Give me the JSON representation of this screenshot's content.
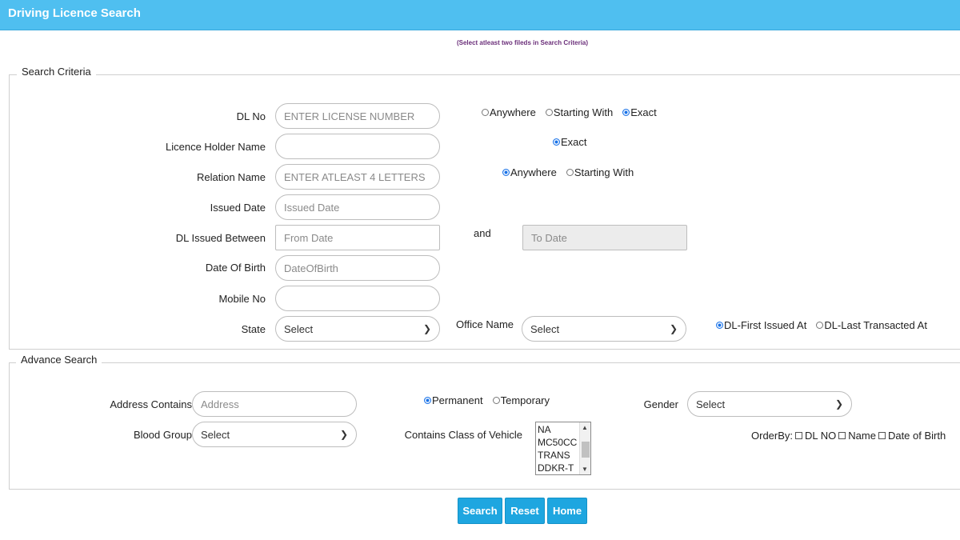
{
  "header": {
    "title": "Driving Licence Search"
  },
  "note": "(Select atleast two fileds in Search Criteria)",
  "search_criteria": {
    "legend": "Search Criteria",
    "dl_no": {
      "label": "DL No",
      "placeholder": "ENTER LICENSE NUMBER",
      "value": ""
    },
    "dl_no_match": {
      "options": [
        "Anywhere",
        "Starting With",
        "Exact"
      ],
      "selected": "Exact"
    },
    "holder_name": {
      "label": "Licence Holder Name",
      "value": ""
    },
    "holder_name_match": {
      "options": [
        "Exact"
      ],
      "selected": "Exact"
    },
    "relation_name": {
      "label": "Relation Name",
      "placeholder": "ENTER ATLEAST 4 LETTERS",
      "value": ""
    },
    "relation_name_match": {
      "options": [
        "Anywhere",
        "Starting With"
      ],
      "selected": "Anywhere"
    },
    "issued_date": {
      "label": "Issued Date",
      "placeholder": "Issued Date"
    },
    "dl_issued_between": {
      "label": "DL Issued Between",
      "from_placeholder": "From Date",
      "and_label": "and",
      "to_placeholder": "To Date"
    },
    "dob": {
      "label": "Date Of Birth",
      "placeholder": "DateOfBirth"
    },
    "mobile": {
      "label": "Mobile No",
      "value": ""
    },
    "state": {
      "label": "State",
      "selected": "Select"
    },
    "office": {
      "label": "Office Name",
      "selected": "Select"
    },
    "office_type": {
      "options": [
        "DL-First Issued At",
        "DL-Last Transacted At"
      ],
      "selected": "DL-First Issued At"
    }
  },
  "advance_search": {
    "legend": "Advance Search",
    "address": {
      "label": "Address Contains",
      "placeholder": "Address"
    },
    "address_type": {
      "options": [
        "Permanent",
        "Temporary"
      ],
      "selected": "Permanent"
    },
    "gender": {
      "label": "Gender",
      "selected": "Select"
    },
    "blood_group": {
      "label": "Blood Group",
      "selected": "Select"
    },
    "vehicle_class": {
      "label": "Contains Class of Vehicle",
      "options": [
        "NA",
        "MC50CC",
        "TRANS",
        "DDKR-T"
      ]
    },
    "order_by": {
      "label": "OrderBy:",
      "options": [
        "DL NO",
        "Name",
        "Date of Birth"
      ]
    }
  },
  "buttons": {
    "search": "Search",
    "reset": "Reset",
    "home": "Home"
  },
  "colors": {
    "header_bg": "#4fbff0",
    "button_bg": "#1ea6e0",
    "note_color": "#6b2f7a"
  }
}
